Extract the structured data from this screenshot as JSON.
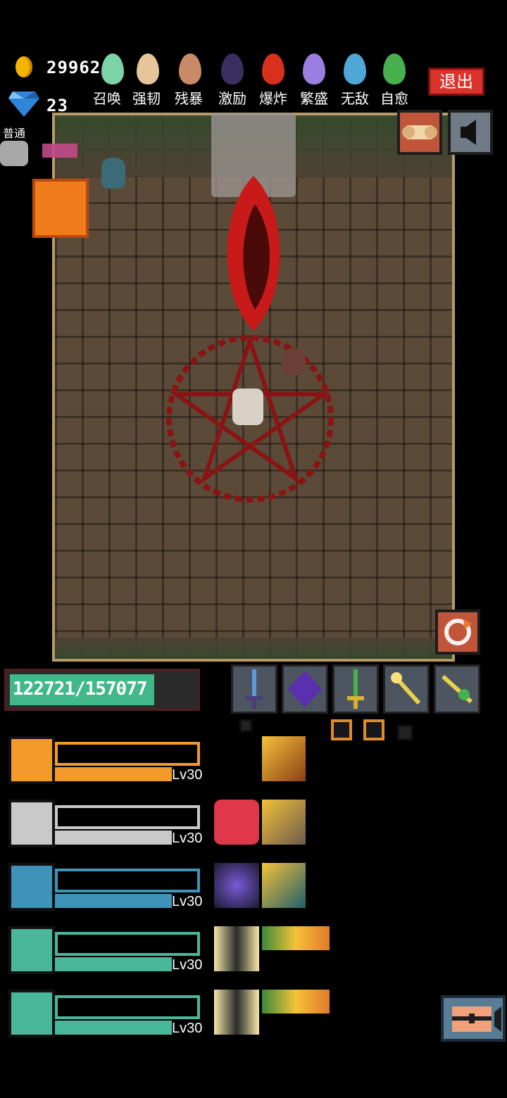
{
  "resources": {
    "coins": "29962",
    "gems": "23"
  },
  "mode": "普通",
  "buffs": [
    {
      "label": "召唤",
      "color": "#7dd3a8"
    },
    {
      "label": "强韧",
      "color": "#e8c49a"
    },
    {
      "label": "残暴",
      "color": "#c98a6a"
    },
    {
      "label": "激励",
      "color": "#3a2f5e"
    },
    {
      "label": "爆炸",
      "color": "#d9301e"
    },
    {
      "label": "繁盛",
      "color": "#9b7fe0"
    },
    {
      "label": "无敌",
      "color": "#4fa7d8"
    },
    {
      "label": "自愈",
      "color": "#49b04e"
    }
  ],
  "exit_label": "退出",
  "hp": {
    "text": "122721/157077",
    "current": 122721,
    "max": 157077
  },
  "weapons": [
    {
      "name": "sword-blue"
    },
    {
      "name": "purple-crystal"
    },
    {
      "name": "green-sword"
    },
    {
      "name": "golden-staff"
    },
    {
      "name": "golden-scepter"
    }
  ],
  "heroes": [
    {
      "level": "Lv30",
      "color": "#f39a2a",
      "border": "#f39a2a"
    },
    {
      "level": "Lv30",
      "color": "#c9c9c9",
      "border": "#c9c9c9"
    },
    {
      "level": "Lv30",
      "color": "#3f93b8",
      "border": "#3f93b8"
    },
    {
      "level": "Lv30",
      "color": "#49b89a",
      "border": "#49b89a"
    },
    {
      "level": "Lv30",
      "color": "#49b89a",
      "border": "#49b89a"
    }
  ],
  "colors": {
    "hp_fill": "#41b88a",
    "exit": "#d9342b",
    "orange_slot": "#f07c1e"
  }
}
